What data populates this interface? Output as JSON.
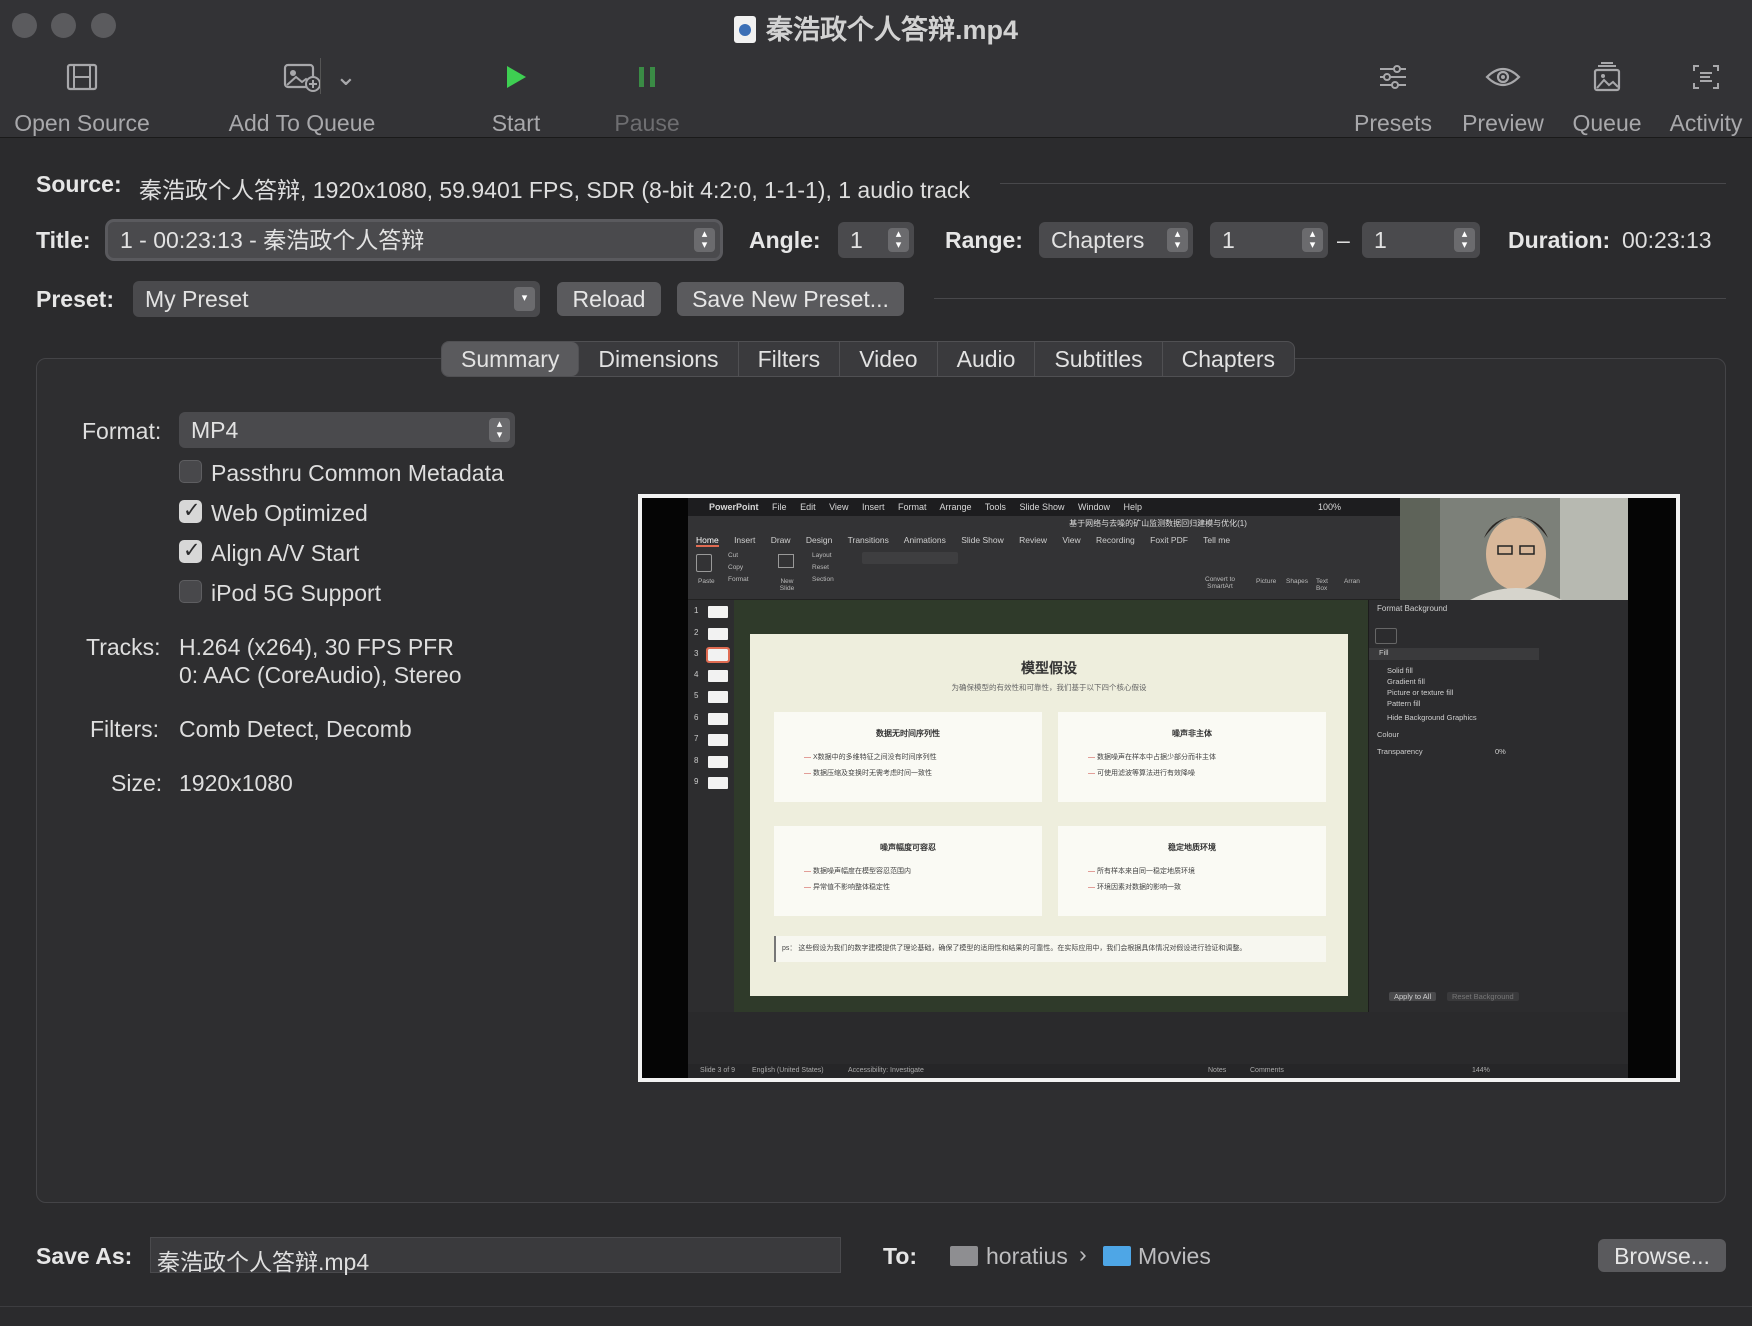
{
  "window": {
    "title": "秦浩政个人答辩.mp4"
  },
  "toolbar": {
    "open_source": "Open Source",
    "add_to_queue": "Add To Queue",
    "start": "Start",
    "pause": "Pause",
    "presets": "Presets",
    "preview": "Preview",
    "queue": "Queue",
    "activity": "Activity"
  },
  "source": {
    "label": "Source:",
    "value": "秦浩政个人答辩, 1920x1080, 59.9401 FPS, SDR (8-bit 4:2:0, 1-1-1), 1 audio track"
  },
  "title_row": {
    "title_label": "Title:",
    "title_value": "1 - 00:23:13 - 秦浩政个人答辩",
    "angle_label": "Angle:",
    "angle_value": "1",
    "range_label": "Range:",
    "range_type": "Chapters",
    "range_start": "1",
    "range_dash": "–",
    "range_end": "1",
    "duration_label": "Duration:",
    "duration_value": "00:23:13"
  },
  "preset_row": {
    "label": "Preset:",
    "value": "My Preset",
    "reload": "Reload",
    "save_new": "Save New Preset..."
  },
  "tabs": [
    "Summary",
    "Dimensions",
    "Filters",
    "Video",
    "Audio",
    "Subtitles",
    "Chapters"
  ],
  "summary": {
    "format_label": "Format:",
    "format_value": "MP4",
    "checkboxes": [
      {
        "label": "Passthru Common Metadata",
        "checked": false
      },
      {
        "label": "Web Optimized",
        "checked": true
      },
      {
        "label": "Align A/V Start",
        "checked": true
      },
      {
        "label": "iPod 5G Support",
        "checked": false
      }
    ],
    "tracks_label": "Tracks:",
    "tracks_line1": "H.264 (x264), 30 FPS PFR",
    "tracks_line2": "0: AAC (CoreAudio), Stereo",
    "filters_label": "Filters:",
    "filters_value": "Comb Detect, Decomb",
    "size_label": "Size:",
    "size_value": "1920x1080"
  },
  "preview_frame": {
    "menubar": [
      "PowerPoint",
      "File",
      "Edit",
      "View",
      "Insert",
      "Format",
      "Arrange",
      "Tools",
      "Slide Show",
      "Window",
      "Help"
    ],
    "doc_title": "基于网络与去噪的矿山监测数据回归建模与优化(1)",
    "ribbon_tabs": [
      "Home",
      "Insert",
      "Draw",
      "Design",
      "Transitions",
      "Animations",
      "Slide Show",
      "Review",
      "View",
      "Recording",
      "Foxit PDF",
      "Tell me"
    ],
    "ribbon": {
      "paste": "Paste",
      "cut": "Cut",
      "copy": "Copy",
      "format": "Format",
      "new_slide": "New Slide",
      "layout": "Layout",
      "reset": "Reset",
      "section": "Section",
      "convert": "Convert to SmartArt",
      "picture": "Picture",
      "shapes": "Shapes",
      "text_box": "Text Box",
      "arrange": "Arran"
    },
    "thumb_numbers": [
      "1",
      "2",
      "3",
      "4",
      "5",
      "6",
      "7",
      "8",
      "9"
    ],
    "slide": {
      "title": "模型假设",
      "subtitle": "为确保模型的有效性和可靠性，我们基于以下四个核心假设",
      "cards": [
        {
          "title": "数据无时间序列性",
          "lines": [
            "X数据中的多维特征之间没有时间序列性",
            "数据压缩及变换时无需考虑时间一致性"
          ]
        },
        {
          "title": "噪声非主体",
          "lines": [
            "数据噪声在样本中占据少部分而非主体",
            "可使用滤波等算法进行有效降噪"
          ]
        },
        {
          "title": "噪声幅度可容忍",
          "lines": [
            "数据噪声幅度在模型容忍范围内",
            "异常值不影响整体稳定性"
          ]
        },
        {
          "title": "稳定地质环境",
          "lines": [
            "所有样本来自同一稳定地质环境",
            "环境因素对数据的影响一致"
          ]
        }
      ],
      "note": "ps： 这些假设为我们的数字建模提供了理论基础，确保了模型的适用性和结果的可靠性。在实际应用中，我们会根据具体情况对假设进行验证和调整。"
    },
    "format_pane": {
      "title": "Format Background",
      "fill": "Fill",
      "options": [
        "Solid fill",
        "Gradient fill",
        "Picture or texture fill",
        "Pattern fill"
      ],
      "hide": "Hide Background Graphics",
      "colour": "Colour",
      "transparency": "Transparency",
      "transparency_value": "0%",
      "apply_all": "Apply to All",
      "reset_bg": "Reset Background"
    },
    "status": {
      "slide": "Slide 3 of 9",
      "lang": "English (United States)",
      "access": "Accessibility: Investigate",
      "notes": "Notes",
      "comments": "Comments",
      "zoom": "144%"
    },
    "zoom_top": "100%"
  },
  "save": {
    "label": "Save As:",
    "value": "秦浩政个人答辩.mp4",
    "to_label": "To:",
    "path1": "horatius",
    "sep": "›",
    "path2": "Movies",
    "browse": "Browse..."
  },
  "colors": {
    "start_green": "#3ecf52",
    "pause_green": "#3a8b45",
    "folder_blue": "#4ea6e6"
  }
}
